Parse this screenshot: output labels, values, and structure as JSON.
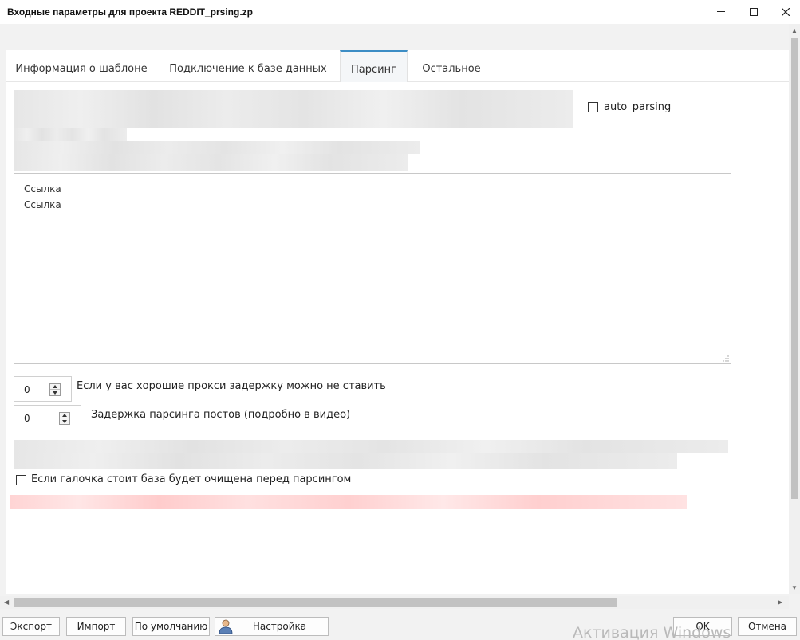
{
  "window": {
    "title": "Входные параметры для проекта REDDIT_prsing.zp",
    "minimize_symbol": "—",
    "maximize_symbol": "☐",
    "close_symbol": "✕"
  },
  "tabs": [
    {
      "label": "Информация о шаблоне",
      "active": false
    },
    {
      "label": "Подключение к базе данных",
      "active": false
    },
    {
      "label": "Парсинг",
      "active": true
    },
    {
      "label": "Остальное",
      "active": false
    }
  ],
  "parsing": {
    "auto_parsing_label": "auto_parsing",
    "auto_parsing_checked": false,
    "links_lines": [
      "Ссылка",
      "Ссылка"
    ],
    "delay_value": "0",
    "delay_label": "Если у вас хорошие прокси задержку можно не ставить",
    "post_delay_value": "0",
    "post_delay_label": "Задержка парсинга постов (подробно в видео)",
    "clear_db_label": "Если галочка стоит база будет очищена перед парсингом",
    "clear_db_checked": false
  },
  "footer": {
    "export_label": "Экспорт",
    "import_label": "Импорт",
    "default_label": "По умолчанию",
    "profile_label": "Настройка профиля",
    "ok_label": "OK",
    "cancel_label": "Отмена"
  },
  "watermark": "Активация Windows",
  "colors": {
    "accent": "#3c8dc5",
    "background": "#f2f2f2",
    "panel": "#ffffff",
    "redacted_gray": "#e6e6e6",
    "redacted_pink": "#ffd4d4"
  }
}
